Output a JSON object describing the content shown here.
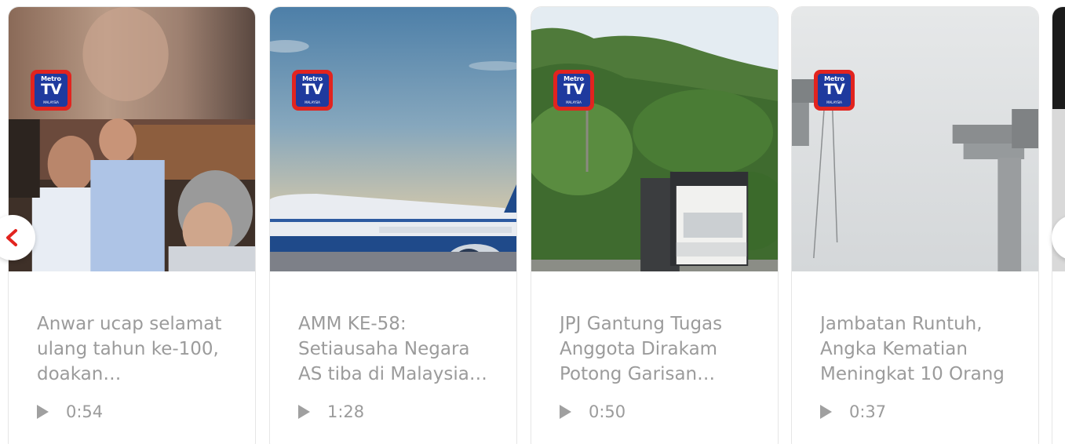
{
  "cards": [
    {
      "logo": {
        "top": "Metro",
        "mid": "TV",
        "bottom": "MALAYSIA"
      },
      "title": "Anwar ucap selamat ulang tahun ke-100, doakan…",
      "duration": "0:54"
    },
    {
      "logo": {
        "top": "Metro",
        "mid": "TV",
        "bottom": "MALAYSIA"
      },
      "title": "AMM KE-58: Setiausaha Negara AS tiba di Malaysia…",
      "duration": "1:28"
    },
    {
      "logo": {
        "top": "Metro",
        "mid": "TV",
        "bottom": "MALAYSIA"
      },
      "title": "JPJ Gantung Tugas Anggota Dirakam Potong Garisan…",
      "duration": "0:50"
    },
    {
      "logo": {
        "top": "Metro",
        "mid": "TV",
        "bottom": "MALAYSIA"
      },
      "title": "Jambatan Runtuh, Angka Kematian Meningkat 10 Orang",
      "duration": "0:37"
    }
  ],
  "nav": {
    "prev_icon": "chevron-left-icon",
    "next_icon": "chevron-right-icon",
    "accent_color": "#e2241f"
  },
  "icons": {
    "play": "play-icon",
    "logo": "metro-tv-logo"
  }
}
